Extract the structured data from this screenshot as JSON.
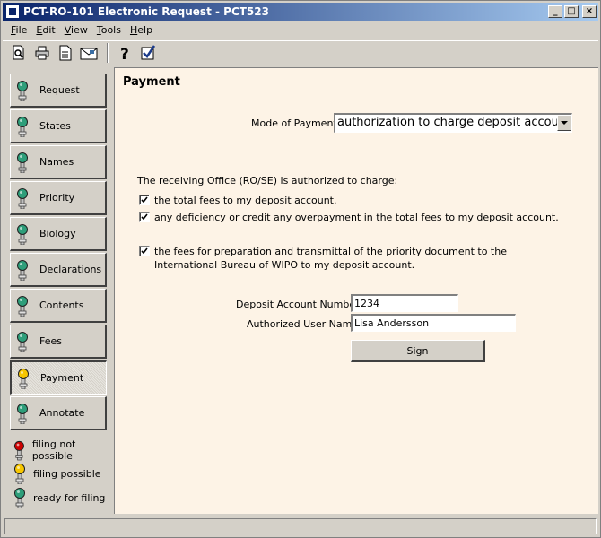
{
  "window": {
    "title": "PCT-RO-101 Electronic Request - PCT523",
    "buttons": {
      "minimize": "_",
      "maximize": "□",
      "close": "×"
    }
  },
  "menu": {
    "items": [
      {
        "label": "File",
        "accel": "F",
        "rest": "ile"
      },
      {
        "label": "Edit",
        "accel": "E",
        "rest": "dit"
      },
      {
        "label": "View",
        "accel": "V",
        "rest": "iew"
      },
      {
        "label": "Tools",
        "accel": "T",
        "rest": "ools"
      },
      {
        "label": "Help",
        "accel": "H",
        "rest": "elp"
      }
    ]
  },
  "toolbar": {
    "icons": [
      "print-preview-icon",
      "print-icon",
      "document-icon",
      "email-icon",
      "help-icon",
      "validate-icon"
    ]
  },
  "sidebar": {
    "items": [
      {
        "label": "Request",
        "status": "ready"
      },
      {
        "label": "States",
        "status": "ready"
      },
      {
        "label": "Names",
        "status": "ready"
      },
      {
        "label": "Priority",
        "status": "ready"
      },
      {
        "label": "Biology",
        "status": "ready"
      },
      {
        "label": "Declarations",
        "status": "ready"
      },
      {
        "label": "Contents",
        "status": "ready"
      },
      {
        "label": "Fees",
        "status": "ready"
      },
      {
        "label": "Payment",
        "status": "possible",
        "active": true
      },
      {
        "label": "Annotate",
        "status": "ready"
      }
    ],
    "legend": [
      {
        "label": "filing not possible",
        "status": "not-possible"
      },
      {
        "label": "filing possible",
        "status": "possible"
      },
      {
        "label": "ready for filing",
        "status": "ready"
      }
    ]
  },
  "colors": {
    "ready": "#2e9e7a",
    "possible": "#f7c600",
    "not-possible": "#cc0000",
    "content_bg": "#fdf3e6"
  },
  "payment": {
    "title": "Payment",
    "mode_label": "Mode of Payment:",
    "mode_value": "authorization to charge deposit account",
    "authorized_text": "The receiving Office (RO/SE) is authorized to charge:",
    "checks": [
      {
        "text": "the total fees to my deposit account.",
        "checked": true
      },
      {
        "text": "any deficiency or credit any overpayment in the total fees to my deposit account.",
        "checked": true
      },
      {
        "text": "the fees for preparation and transmittal of the priority document to the International Bureau of WIPO to my deposit account.",
        "checked": true
      }
    ],
    "account_label": "Deposit Account Number:",
    "account_value": "1234",
    "user_label": "Authorized User Name:",
    "user_value": "Lisa Andersson",
    "sign_label": "Sign"
  }
}
